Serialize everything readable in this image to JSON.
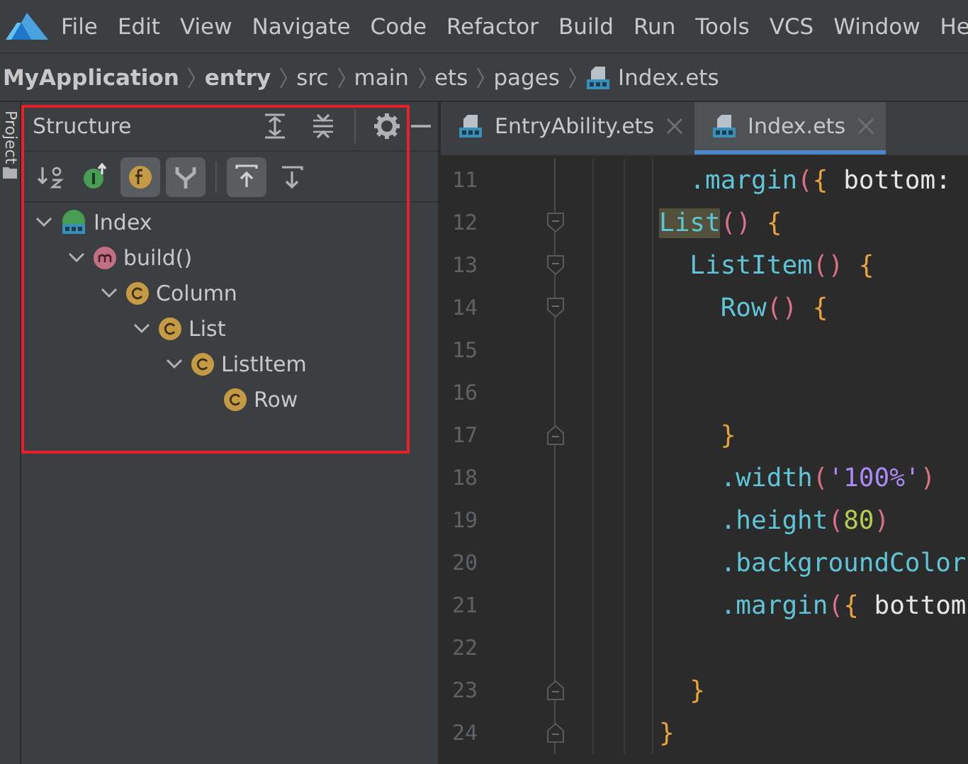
{
  "menu": [
    "File",
    "Edit",
    "View",
    "Navigate",
    "Code",
    "Refactor",
    "Build",
    "Run",
    "Tools",
    "VCS",
    "Window",
    "He"
  ],
  "breadcrumbs": [
    {
      "label": "MyApplication",
      "bold": true,
      "kind": "folder"
    },
    {
      "label": "entry",
      "bold": true,
      "kind": "folder"
    },
    {
      "label": "src",
      "bold": false,
      "kind": "folder"
    },
    {
      "label": "main",
      "bold": false,
      "kind": "folder"
    },
    {
      "label": "ets",
      "bold": false,
      "kind": "folder"
    },
    {
      "label": "pages",
      "bold": false,
      "kind": "folder"
    },
    {
      "label": "Index.ets",
      "bold": false,
      "kind": "file"
    }
  ],
  "side_stripe": {
    "label": "Project"
  },
  "structure": {
    "title": "Structure",
    "toolbar": [
      {
        "kind": "sort",
        "on": false
      },
      {
        "kind": "inherited",
        "on": false
      },
      {
        "kind": "fields",
        "on": true
      },
      {
        "kind": "branch",
        "on": true
      },
      {
        "kind": "sep"
      },
      {
        "kind": "up",
        "on": true
      },
      {
        "kind": "down",
        "on": false
      }
    ],
    "tree": [
      {
        "label": "Index",
        "kind": "ets",
        "expanded": true,
        "children": [
          {
            "label": "build()",
            "kind": "method",
            "expanded": true,
            "children": [
              {
                "label": "Column",
                "kind": "component",
                "expanded": true,
                "children": [
                  {
                    "label": "List",
                    "kind": "component",
                    "expanded": true,
                    "children": [
                      {
                        "label": "ListItem",
                        "kind": "component",
                        "expanded": true,
                        "children": [
                          {
                            "label": "Row",
                            "kind": "component"
                          }
                        ]
                      }
                    ]
                  }
                ]
              }
            ]
          }
        ]
      }
    ]
  },
  "editor": {
    "tabs": [
      {
        "label": "EntryAbility.ets",
        "selected": false
      },
      {
        "label": "Index.ets",
        "selected": true
      }
    ],
    "lines": [
      {
        "number": "11",
        "fold_start": false,
        "fold_end": false,
        "tokens": [
          {
            "kind": "method",
            "text": "  .margin"
          },
          {
            "kind": "paren",
            "text": "("
          },
          {
            "kind": "brace",
            "text": "{"
          },
          {
            "kind": "plain",
            "text": " bottom:"
          }
        ]
      },
      {
        "number": "12",
        "fold_start": true,
        "fold_end": false,
        "tokens": [
          {
            "kind": "method",
            "text": "List",
            "highlight": true
          },
          {
            "kind": "paren",
            "text": "()"
          },
          {
            "kind": "brace",
            "text": " {"
          }
        ]
      },
      {
        "number": "13",
        "fold_start": true,
        "fold_end": false,
        "tokens": [
          {
            "kind": "method",
            "text": "  ListItem"
          },
          {
            "kind": "paren",
            "text": "()"
          },
          {
            "kind": "brace",
            "text": " {"
          }
        ]
      },
      {
        "number": "14",
        "fold_start": true,
        "fold_end": false,
        "tokens": [
          {
            "kind": "method",
            "text": "    Row"
          },
          {
            "kind": "paren",
            "text": "()"
          },
          {
            "kind": "brace",
            "text": " {"
          }
        ]
      },
      {
        "number": "15",
        "fold_start": false,
        "fold_end": false
      },
      {
        "number": "16",
        "fold_start": false,
        "fold_end": false
      },
      {
        "number": "17",
        "fold_start": false,
        "fold_end": true,
        "tokens": [
          {
            "kind": "brace",
            "text": "    }"
          }
        ]
      },
      {
        "number": "18",
        "fold_start": false,
        "fold_end": false,
        "tokens": [
          {
            "kind": "method",
            "text": "    .width"
          },
          {
            "kind": "paren",
            "text": "("
          },
          {
            "kind": "string",
            "text": "'100%'"
          },
          {
            "kind": "paren",
            "text": ")"
          }
        ]
      },
      {
        "number": "19",
        "fold_start": false,
        "fold_end": false,
        "tokens": [
          {
            "kind": "method",
            "text": "    .height"
          },
          {
            "kind": "paren",
            "text": "("
          },
          {
            "kind": "number",
            "text": "80"
          },
          {
            "kind": "paren",
            "text": ")"
          }
        ]
      },
      {
        "number": "20",
        "fold_start": false,
        "fold_end": false,
        "tokens": [
          {
            "kind": "method",
            "text": "    .backgroundColor"
          }
        ]
      },
      {
        "number": "21",
        "fold_start": false,
        "fold_end": false,
        "tokens": [
          {
            "kind": "method",
            "text": "    .margin"
          },
          {
            "kind": "paren",
            "text": "("
          },
          {
            "kind": "brace",
            "text": "{"
          },
          {
            "kind": "plain",
            "text": " bottom"
          }
        ]
      },
      {
        "number": "22",
        "fold_start": false,
        "fold_end": false
      },
      {
        "number": "23",
        "fold_start": false,
        "fold_end": true,
        "tokens": [
          {
            "kind": "brace",
            "text": "  }"
          }
        ]
      },
      {
        "number": "24",
        "fold_start": false,
        "fold_end": true,
        "tokens": [
          {
            "kind": "brace",
            "text": "}"
          }
        ]
      }
    ]
  }
}
